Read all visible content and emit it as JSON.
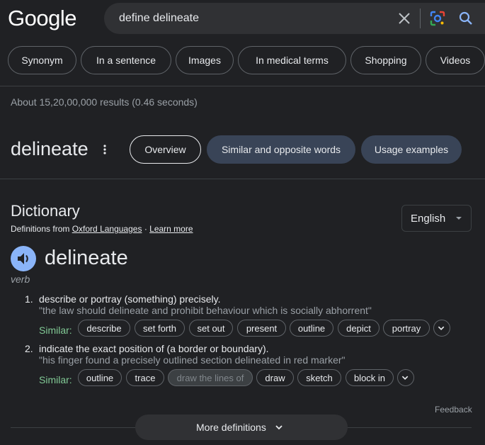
{
  "logo": "Google",
  "search": {
    "query": "define delineate"
  },
  "chips": [
    "Synonym",
    "In a sentence",
    "Images",
    "In medical terms",
    "Shopping",
    "Videos"
  ],
  "stats": "About 15,20,00,000 results (0.46 seconds)",
  "word": "delineate",
  "tabs": [
    {
      "label": "Overview",
      "active": true
    },
    {
      "label": "Similar and opposite words",
      "active": false
    },
    {
      "label": "Usage examples",
      "active": false
    }
  ],
  "dictionary": {
    "title": "Dictionary",
    "source_prefix": "Definitions from",
    "source_link": "Oxford Languages",
    "separator": "·",
    "learn_more": "Learn more",
    "language": "English",
    "headword": "delineate",
    "part_of_speech": "verb",
    "similar_label": "Similar:",
    "definitions": [
      {
        "num": "1.",
        "text": "describe or portray (something) precisely.",
        "example": "\"the law should delineate and prohibit behaviour which is socially abhorrent\"",
        "similar": [
          "describe",
          "set forth",
          "set out",
          "present",
          "outline",
          "depict",
          "portray"
        ]
      },
      {
        "num": "2.",
        "text": "indicate the exact position of (a border or boundary).",
        "example": "\"his finger found a precisely outlined section delineated in red marker\"",
        "similar": [
          "outline",
          "trace",
          "draw the lines of",
          "draw",
          "sketch",
          "block in"
        ]
      }
    ]
  },
  "feedback": "Feedback",
  "more_definitions": "More definitions",
  "colors": {
    "background": "#202124",
    "accent_blue": "#8ab4f8",
    "similar_green": "#81c995",
    "tab_inactive": "#394457"
  }
}
